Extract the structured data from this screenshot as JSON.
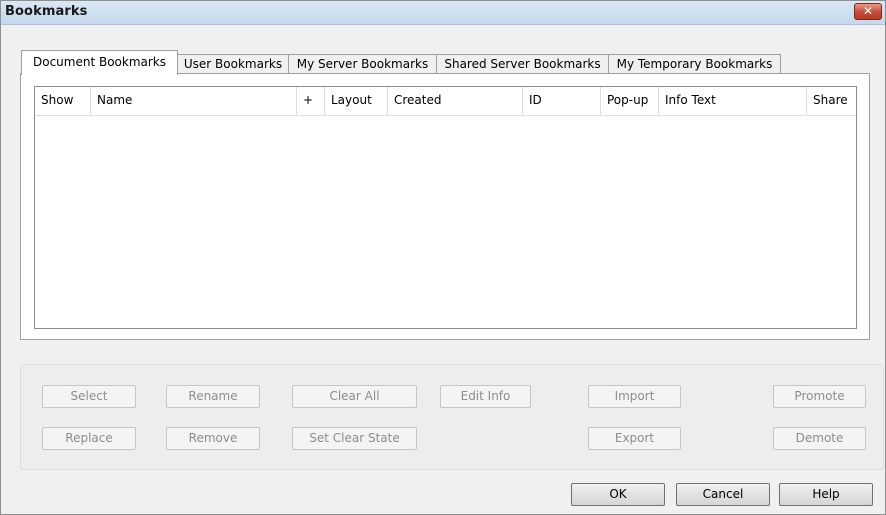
{
  "window": {
    "title": "Bookmarks",
    "close_glyph": "✕"
  },
  "tabs": [
    {
      "label": "Document Bookmarks",
      "active": true
    },
    {
      "label": "User Bookmarks",
      "active": false
    },
    {
      "label": "My Server Bookmarks",
      "active": false
    },
    {
      "label": "Shared Server Bookmarks",
      "active": false
    },
    {
      "label": "My Temporary Bookmarks",
      "active": false
    }
  ],
  "table": {
    "columns": [
      "Show",
      "Name",
      "+",
      "Layout",
      "Created",
      "ID",
      "Pop-up",
      "Info Text",
      "Share"
    ],
    "rows": []
  },
  "actions": {
    "select": "Select",
    "rename": "Rename",
    "clear_all": "Clear All",
    "edit_info": "Edit Info",
    "import": "Import",
    "promote": "Promote",
    "replace": "Replace",
    "remove": "Remove",
    "set_clear_state": "Set Clear State",
    "export": "Export",
    "demote": "Demote"
  },
  "footer": {
    "ok": "OK",
    "cancel": "Cancel",
    "help": "Help"
  }
}
